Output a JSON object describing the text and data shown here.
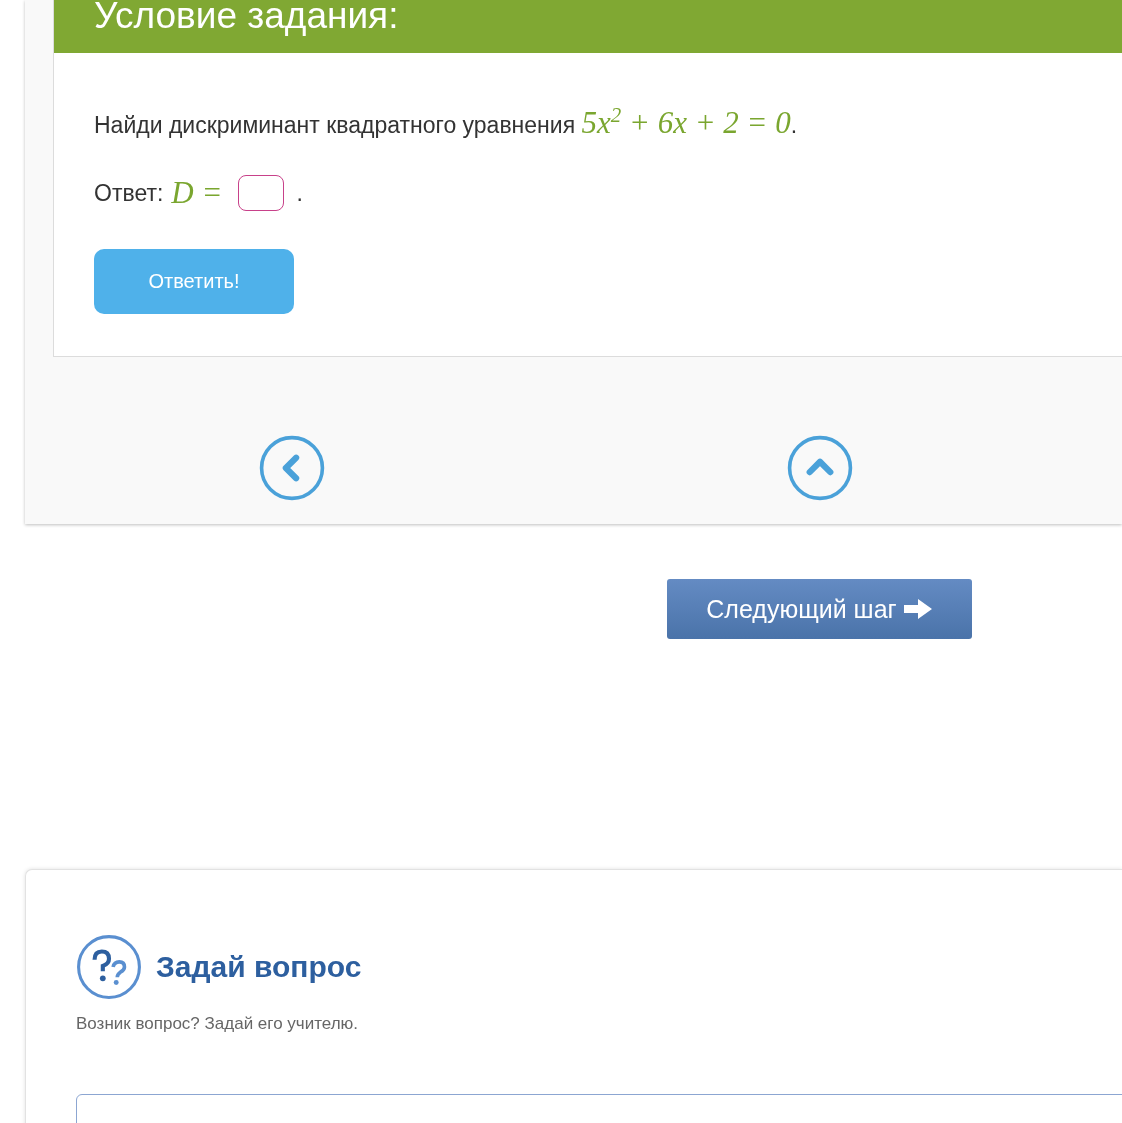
{
  "task_card": {
    "title": "Условие задания:",
    "question": {
      "text": "Найди дискриминант квадратного уравнения ",
      "formula": "5x$^{2}$ + 6x + 2 = 0",
      "end": "."
    },
    "answer": {
      "label": "Ответ:",
      "formula": "D =",
      "end": "."
    },
    "submit_button": "Ответить!",
    "nav": [
      {
        "kind": "previous"
      },
      {
        "kind": "list"
      }
    ]
  },
  "next_button": "Следующий шаг",
  "ask_card": {
    "title": "Задай вопрос",
    "subtitle": "Возник вопрос? Задай его учителю."
  }
}
